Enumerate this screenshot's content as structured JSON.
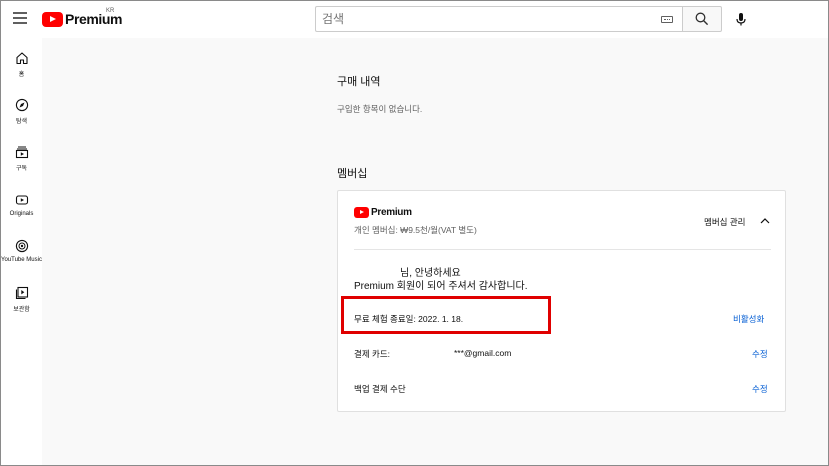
{
  "header": {
    "logo_text": "Premium",
    "region": "KR",
    "search_placeholder": "검색"
  },
  "sidebar": {
    "items": [
      {
        "label": "홈",
        "icon": "home-icon"
      },
      {
        "label": "탐색",
        "icon": "compass-icon"
      },
      {
        "label": "구독",
        "icon": "subscriptions-icon"
      },
      {
        "label": "Originals",
        "icon": "originals-icon"
      },
      {
        "label": "YouTube Music",
        "icon": "music-icon"
      },
      {
        "label": "보관함",
        "icon": "library-icon"
      }
    ]
  },
  "purchases": {
    "title": "구매 내역",
    "empty_text": "구입한 항목이 없습니다."
  },
  "membership": {
    "title": "멤버십",
    "card": {
      "logo_text": "Premium",
      "plan": "개인 멤버십: ₩9.5천/월(VAT 별도)",
      "manage_label": "멤버십 관리",
      "greeting_suffix": "님, 안녕하세요",
      "thanks": "Premium 회원이 되어 주셔서 감사합니다.",
      "trial_label": "무료 체험 종료일: 2022. 1. 18.",
      "deactivate_link": "비활성화",
      "card_label": "결제 카드:",
      "card_value": "***@gmail.com",
      "edit_link": "수정",
      "backup_label": "백업 결제 수단",
      "backup_edit_link": "수정"
    }
  },
  "colors": {
    "brand_red": "#ff0000",
    "link_blue": "#065fd4",
    "highlight_box": "#e00000",
    "background": "#f9f9f9"
  }
}
